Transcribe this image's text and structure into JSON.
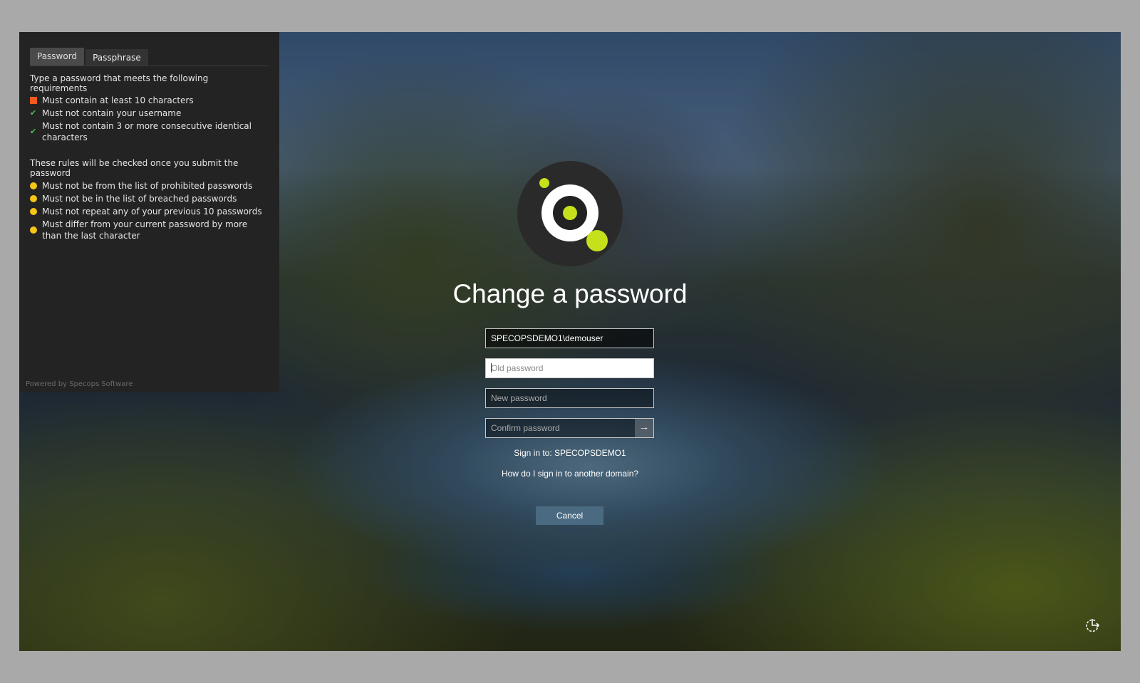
{
  "panel": {
    "tabs": [
      {
        "label": "Password",
        "active": true
      },
      {
        "label": "Passphrase",
        "active": false
      }
    ],
    "intro": "Type a password that meets the following requirements",
    "requirements": [
      {
        "text": "Must contain at least 10 characters",
        "status": "failed",
        "icon": "red-square-icon"
      },
      {
        "text": "Must not contain your username",
        "status": "passed",
        "icon": "check-icon"
      },
      {
        "text": "Must not contain 3 or more consecutive identical characters",
        "status": "passed",
        "icon": "check-icon"
      }
    ],
    "note": "These rules will be checked once you submit the password",
    "submit_rules": [
      {
        "text": "Must not be from the list of prohibited passwords",
        "status": "pending"
      },
      {
        "text": "Must not be in the list of breached passwords",
        "status": "pending"
      },
      {
        "text": "Must not repeat any of your previous 10 passwords",
        "status": "pending"
      },
      {
        "text": "Must differ from your current password by more than the last character",
        "status": "pending"
      }
    ],
    "powered_by": "Powered by Specops Software"
  },
  "main": {
    "title": "Change a password",
    "username": "SPECOPSDEMO1\\demouser",
    "old_password_placeholder": "Old password",
    "new_password_placeholder": "New password",
    "confirm_password_placeholder": "Confirm password",
    "sign_in_to": "Sign in to: SPECOPSDEMO1",
    "other_domain": "How do I sign in to another domain?",
    "cancel": "Cancel"
  },
  "colors": {
    "failed": "#f05a1a",
    "passed": "#4cc24c",
    "pending": "#f5c518",
    "logo_accent": "#c6e01c"
  }
}
